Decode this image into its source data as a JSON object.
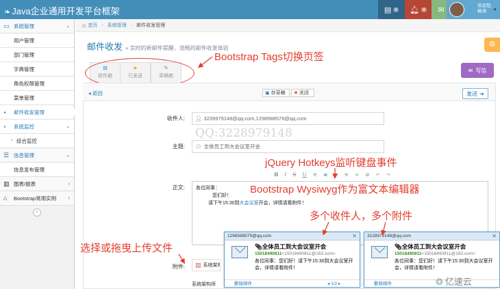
{
  "app": {
    "brand": "Java企业通用开发平台框架",
    "nav": [
      {
        "icon": "tasks-icon",
        "count": "4"
      },
      {
        "icon": "bell-icon",
        "count": "8"
      },
      {
        "icon": "envelope-icon",
        "count": "5"
      }
    ],
    "user": {
      "greeting_line1": "欢迎您,",
      "greeting_line2": "杨涛"
    }
  },
  "sidebar": {
    "items": [
      {
        "label": "系统管理",
        "icon": "desktop-icon",
        "expanded": true
      },
      {
        "label": "用户管理"
      },
      {
        "label": "部门管理"
      },
      {
        "label": "字典管理"
      },
      {
        "label": "角色权限管理"
      },
      {
        "label": "菜单管理"
      },
      {
        "label": "邮件收发管理",
        "active": true
      },
      {
        "label": "系统监控"
      },
      {
        "label": "综合监控"
      },
      {
        "label": "信息管理",
        "icon": "list-icon"
      },
      {
        "label": "信息发布管理"
      },
      {
        "label": "图表/报表",
        "icon": "bar-chart-icon"
      },
      {
        "label": "Bootstrap常用实例",
        "icon": "tag-icon"
      }
    ]
  },
  "breadcrumbs": {
    "home": "首页",
    "level1": "系统管理",
    "current": "邮件收发管理"
  },
  "page": {
    "title": "邮件收发",
    "subtitle": "» 实时的新邮件提醒，流畅的邮件收发体验"
  },
  "tabs": [
    {
      "label": "收件箱",
      "icon": "inbox-icon"
    },
    {
      "label": "已发送",
      "icon": "location-arrow-icon"
    },
    {
      "label": "草稿箱",
      "icon": "pencil-icon"
    }
  ],
  "compose_label": "写信",
  "toolbar": {
    "back": "返回",
    "save_draft": "存草稿",
    "close": "关闭",
    "send": "发送"
  },
  "form": {
    "recipients_label": "收件人:",
    "recipients_value": "3228979148@qq.com,1298588579@qq.com",
    "subject_label": "主题:",
    "subject_value": "全体员工到大会议室开会",
    "body_label": "正文:",
    "attachment_label": "附件:",
    "attachment_name": "系统架构",
    "signature": "系统架构师"
  },
  "watermark": "QQ:3228979148",
  "editor": {
    "toolbar": [
      "B",
      "I",
      "S",
      "U"
    ],
    "line1": "各位同事：",
    "line2": "您们好！",
    "line3_prefix": "请下午15:30到",
    "line3_highlight": "大会议室",
    "line3_suffix": "开会，详情请看附件！"
  },
  "annotations": {
    "tags": "Bootstrap Tags切换页签",
    "hotkeys": "jQuery Hotkeys监听键盘事件",
    "wysiwyg": "Bootstrap Wysiwyg作为富文本编辑器",
    "multi": "多个收件人，多个附件",
    "upload": "选择或拖曳上传文件"
  },
  "popups": [
    {
      "to": "1298588579@qq.com",
      "title": "全体员工到大会议室开会",
      "from_phone": "15018490811",
      "from_email": "<15018490811@163.com>",
      "body": "各位同事：您们好！请下午15:30到大会议室开会，详情请看附件！",
      "delete": "删除邮件",
      "page": "1/2"
    },
    {
      "to": "3228979148@qq.com",
      "title": "全体员工到大会议室开会",
      "from_phone": "15018490811",
      "from_email": "<15018490811@163.com>",
      "body": "各位同事：您们好！请下午15:30到大会议室开会，详情请看附件！",
      "delete": "删除邮件",
      "page": ""
    }
  ],
  "footer_logo": "亿速云"
}
